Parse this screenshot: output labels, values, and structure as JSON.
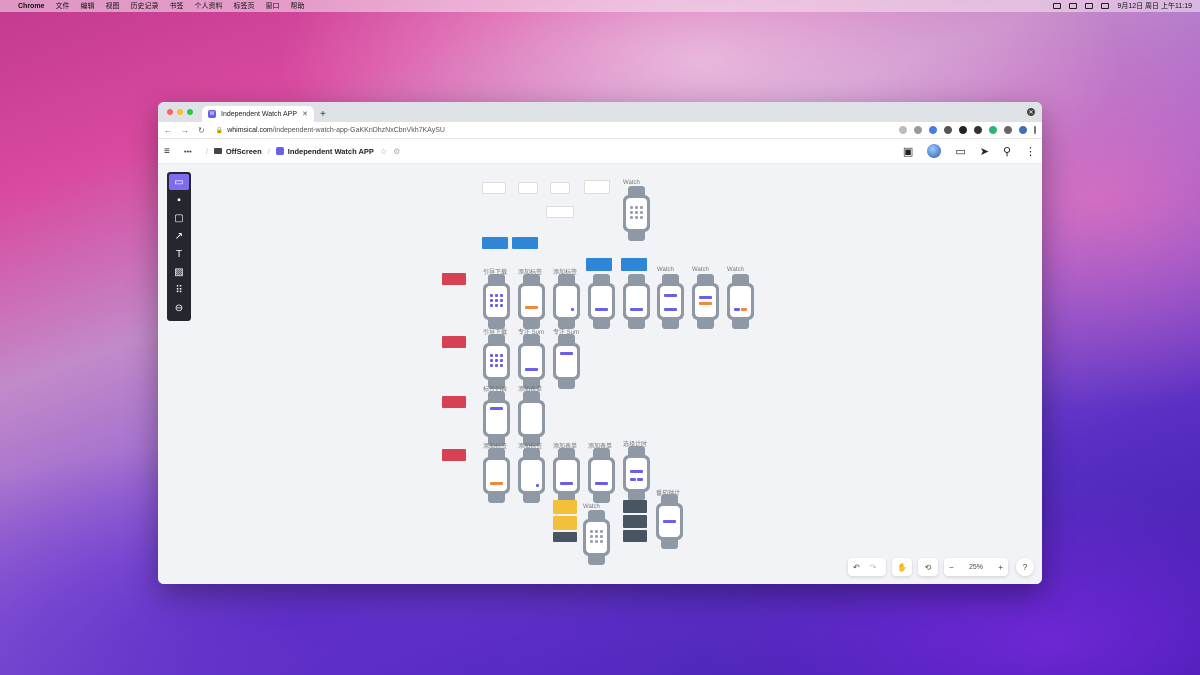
{
  "menubar": {
    "app": "Chrome",
    "items": [
      "文件",
      "编辑",
      "视图",
      "历史记录",
      "书签",
      "个人资料",
      "标签页",
      "窗口",
      "帮助"
    ],
    "clock": "9月12日 周日 上午11:19"
  },
  "browser": {
    "tab_title": "Independent Watch APP",
    "url_host": "whimsical.com",
    "url_path": "/independent-watch-app-GaKKnDhzNxCbnVkh7KAySU"
  },
  "app": {
    "breadcrumb_folder": "OffScreen",
    "doc_title": "Independent Watch APP",
    "dots": "•••"
  },
  "canvas": {
    "labels": {
      "watch_top": "Watch",
      "r1_1": "引导下载",
      "r1_2": "添加标签",
      "r1_3": "添加标签",
      "r1_w1": "Watch",
      "r1_w2": "Watch",
      "r1_w3": "Watch",
      "r2_1": "引导下载",
      "r2_2": "专注 Sum",
      "r2_3": "专注 Sum",
      "r3_1": "标签列表",
      "r3_2": "添加表单",
      "r4_1": "添加标签",
      "r4_2": "添加标签",
      "r4_3": "添加表单",
      "r4_4": "添加表单",
      "r4_5": "选择计时",
      "r5_1": "Watch",
      "r5_2": "番茄钟计"
    }
  },
  "zoom": {
    "level": "25%",
    "minus": "−",
    "plus": "+",
    "help": "?"
  },
  "colors": {
    "accent": "#6b5ee8",
    "canvas_bg": "#f1f3f6",
    "watch_gray": "#8f98a5",
    "sticky_red": "#d64255",
    "sticky_blue": "#2f86d6",
    "sticky_yellow": "#f3c03a",
    "orange": "#f0883e"
  },
  "icons": [
    "apple-icon",
    "hamburger-icon",
    "folder-icon",
    "star-icon",
    "share-icon",
    "comment-icon",
    "send-icon",
    "search-icon",
    "more-icon",
    "undo-icon",
    "redo-icon",
    "hand-icon",
    "history-icon"
  ]
}
